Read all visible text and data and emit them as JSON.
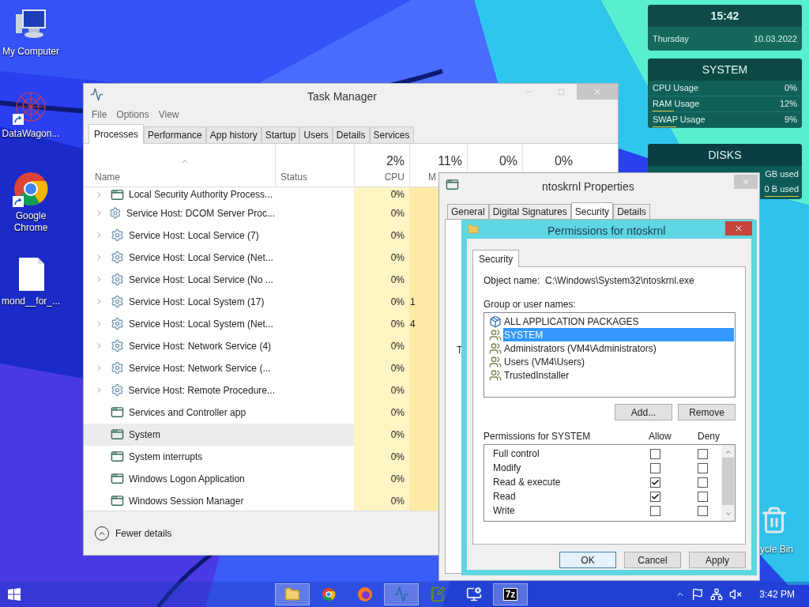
{
  "desktop_icons": [
    {
      "label": "My Computer",
      "kind": "computer",
      "shortcut": false
    },
    {
      "label": "DataWagon...",
      "kind": "network",
      "shortcut": true
    },
    {
      "label": "Google Chrome",
      "kind": "chrome",
      "shortcut": true
    },
    {
      "label": "mond__for_...",
      "kind": "document",
      "shortcut": false
    }
  ],
  "recycle_bin": {
    "label": "ycle Bin"
  },
  "clock_widget": {
    "time": "15:42",
    "day": "Thursday",
    "date": "10.03.2022"
  },
  "system_widget": {
    "title": "SYSTEM",
    "rows": [
      {
        "label": "CPU Usage",
        "value": "0%",
        "underlined": false
      },
      {
        "label": "RAM Usage",
        "value": "12%",
        "underlined": true
      },
      {
        "label": "SWAP Usage",
        "value": "9%",
        "underlined": true
      }
    ]
  },
  "disks_widget": {
    "title": "DISKS",
    "rows": [
      {
        "value": "GB used",
        "underlined": false
      },
      {
        "value": "0 B used",
        "underlined": true
      }
    ]
  },
  "task_manager": {
    "title": "Task Manager",
    "menu": [
      "File",
      "Options",
      "View"
    ],
    "tabs": [
      {
        "label": "Processes",
        "selected": true
      },
      {
        "label": "Performance",
        "selected": false
      },
      {
        "label": "App history",
        "selected": false
      },
      {
        "label": "Startup",
        "selected": false
      },
      {
        "label": "Users",
        "selected": false
      },
      {
        "label": "Details",
        "selected": false
      },
      {
        "label": "Services",
        "selected": false
      }
    ],
    "columns": [
      {
        "label": "Name",
        "sorted": true
      },
      {
        "label": "Status",
        "sorted": false
      },
      {
        "label": "CPU",
        "total": "2%",
        "sorted": false
      },
      {
        "label": "M",
        "total": "11%",
        "sorted": false
      },
      {
        "total": "0%",
        "sorted": false
      },
      {
        "total": "0%",
        "sorted": false
      }
    ],
    "rows": [
      {
        "name": "Local Security Authority Process...",
        "kind": "app",
        "expandable": true,
        "selected": false,
        "cpu": "0%"
      },
      {
        "name": "Service Host: DCOM Server Proc...",
        "kind": "service",
        "expandable": true,
        "selected": false,
        "cpu": "0%"
      },
      {
        "name": "Service Host: Local Service (7)",
        "kind": "service",
        "expandable": true,
        "selected": false,
        "cpu": "0%"
      },
      {
        "name": "Service Host: Local Service (Net...",
        "kind": "service",
        "expandable": true,
        "selected": false,
        "cpu": "0%"
      },
      {
        "name": "Service Host: Local Service (No ...",
        "kind": "service",
        "expandable": true,
        "selected": false,
        "cpu": "0%"
      },
      {
        "name": "Service Host: Local System (17)",
        "kind": "service",
        "expandable": true,
        "selected": false,
        "cpu": "0%",
        "memory": "1"
      },
      {
        "name": "Service Host: Local System (Net...",
        "kind": "service",
        "expandable": true,
        "selected": false,
        "cpu": "0%",
        "memory": "4"
      },
      {
        "name": "Service Host: Network Service (4)",
        "kind": "service",
        "expandable": true,
        "selected": false,
        "cpu": "0%"
      },
      {
        "name": "Service Host: Network Service (...",
        "kind": "service",
        "expandable": true,
        "selected": false,
        "cpu": "0%"
      },
      {
        "name": "Service Host: Remote Procedure...",
        "kind": "service",
        "expandable": true,
        "selected": false,
        "cpu": "0%"
      },
      {
        "name": "Services and Controller app",
        "kind": "app",
        "expandable": false,
        "selected": false,
        "cpu": "0%"
      },
      {
        "name": "System",
        "kind": "app",
        "expandable": false,
        "selected": true,
        "cpu": "0%"
      },
      {
        "name": "System interrupts",
        "kind": "app",
        "expandable": false,
        "selected": false,
        "cpu": "0%"
      },
      {
        "name": "Windows Logon Application",
        "kind": "app",
        "expandable": false,
        "selected": false,
        "cpu": "0%"
      },
      {
        "name": "Windows Session Manager",
        "kind": "app",
        "expandable": false,
        "selected": false,
        "cpu": "0%"
      }
    ],
    "footer": "Fewer details"
  },
  "properties": {
    "title": "ntoskrnl Properties",
    "tabs": [
      {
        "label": "General",
        "selected": false
      },
      {
        "label": "Digital Signatures",
        "selected": false
      },
      {
        "label": "Security",
        "selected": true
      },
      {
        "label": "Details",
        "selected": false
      }
    ],
    "cut_label": "T"
  },
  "permissions": {
    "title": "Permissions for ntoskrnl",
    "tab": "Security",
    "object_label": "Object name:",
    "object_value": "C:\\Windows\\System32\\ntoskrnl.exe",
    "groups_label": "Group or user names:",
    "groups": [
      {
        "name": "ALL APPLICATION PACKAGES",
        "kind": "package",
        "selected": false
      },
      {
        "name": "SYSTEM",
        "kind": "group",
        "selected": true
      },
      {
        "name": "Administrators (VM4\\Administrators)",
        "kind": "group",
        "selected": false
      },
      {
        "name": "Users (VM4\\Users)",
        "kind": "group",
        "selected": false
      },
      {
        "name": "TrustedInstaller",
        "kind": "group",
        "selected": false
      }
    ],
    "list_buttons": [
      "Add...",
      "Remove"
    ],
    "permissions_label": "Permissions for SYSTEM",
    "allow_label": "Allow",
    "deny_label": "Deny",
    "permissions": [
      {
        "name": "Full control",
        "allow": false,
        "deny": false
      },
      {
        "name": "Modify",
        "allow": false,
        "deny": false
      },
      {
        "name": "Read & execute",
        "allow": true,
        "deny": false
      },
      {
        "name": "Read",
        "allow": true,
        "deny": false
      },
      {
        "name": "Write",
        "allow": false,
        "deny": false
      }
    ],
    "buttons": [
      {
        "label": "OK",
        "default": true
      },
      {
        "label": "Cancel",
        "default": false
      },
      {
        "label": "Apply",
        "default": false
      }
    ]
  },
  "taskbar": {
    "apps": [
      {
        "kind": "explorer",
        "active": true
      },
      {
        "kind": "chrome",
        "active": false
      },
      {
        "kind": "firefox",
        "active": false
      },
      {
        "kind": "task-manager",
        "active": true
      },
      {
        "kind": "notepad",
        "active": false
      },
      {
        "kind": "remote",
        "active": false
      },
      {
        "kind": "archiver",
        "active": true,
        "glyph": "7z"
      }
    ],
    "time": "3:42 PM"
  }
}
